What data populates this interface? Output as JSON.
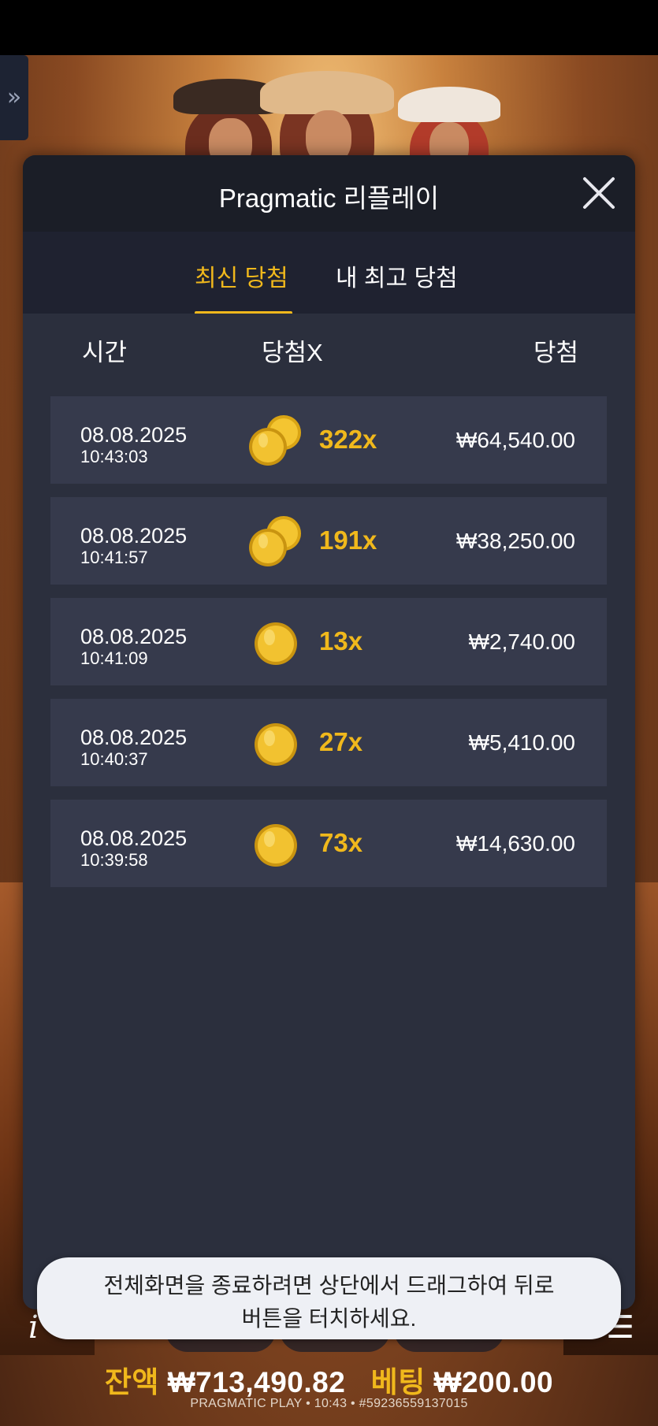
{
  "modal": {
    "title": "Pragmatic 리플레이"
  },
  "tabs": {
    "latest": "최신 당첨",
    "my_best": "내 최고 당첨"
  },
  "columns": {
    "time": "시간",
    "multiplier": "당첨X",
    "win": "당첨"
  },
  "rows": [
    {
      "date": "08.08.2025",
      "time": "10:43:03",
      "multiplier": "322x",
      "amount": "₩64,540.00",
      "coin_icon": "double-coin-icon"
    },
    {
      "date": "08.08.2025",
      "time": "10:41:57",
      "multiplier": "191x",
      "amount": "₩38,250.00",
      "coin_icon": "double-coin-icon"
    },
    {
      "date": "08.08.2025",
      "time": "10:41:09",
      "multiplier": "13x",
      "amount": "₩2,740.00",
      "coin_icon": "single-coin-icon"
    },
    {
      "date": "08.08.2025",
      "time": "10:40:37",
      "multiplier": "27x",
      "amount": "₩5,410.00",
      "coin_icon": "single-coin-icon"
    },
    {
      "date": "08.08.2025",
      "time": "10:39:58",
      "multiplier": "73x",
      "amount": "₩14,630.00",
      "coin_icon": "single-coin-icon"
    }
  ],
  "toast": {
    "line1": "전체화면을 종료하려면 상단에서 드래그하여 뒤로",
    "line2": "버튼을 터치하세요."
  },
  "game_bar": {
    "balance_label": "잔액",
    "balance_value": "₩713,490.82",
    "bet_label": "베팅",
    "bet_value": "₩200.00",
    "footer": "PRAGMATIC PLAY • 10:43 • #59236559137015",
    "side_tab_glyph": "»",
    "info_glyph": "i",
    "menu_glyph": "☰"
  },
  "colors": {
    "accent": "#f0b81c",
    "modal_bg": "#2b2f3d",
    "header_bg": "#1b1e27",
    "row_bg": "#363a4c"
  }
}
